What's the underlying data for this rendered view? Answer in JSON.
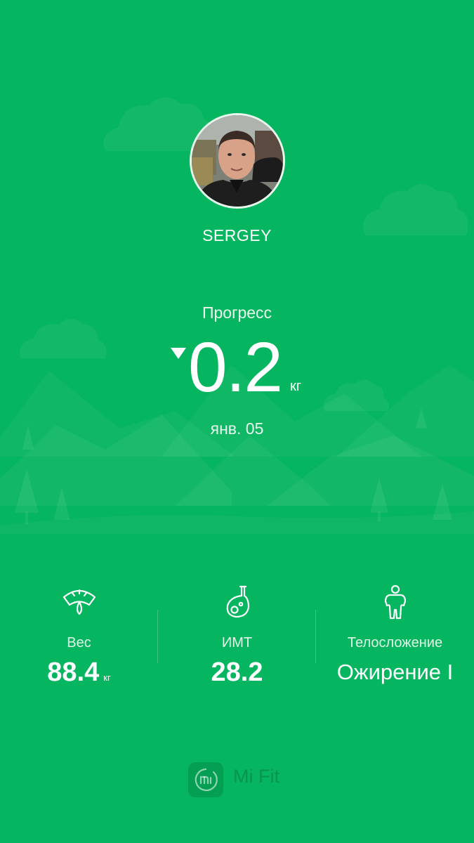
{
  "app": {
    "brand_name": "Mi Fit",
    "accent_color": "#06b55f",
    "icons": {
      "brand_logo": "mi-logo-icon",
      "trend": "triangle-down-icon"
    }
  },
  "profile": {
    "name": "SERGEY",
    "avatar_icon": "user-photo"
  },
  "progress": {
    "label": "Прогресс",
    "direction": "down",
    "value": "0.2",
    "unit": "кг",
    "date": "янв. 05"
  },
  "stats": [
    {
      "icon": "scale-icon",
      "label": "Вес",
      "value": "88.4",
      "unit": "кг"
    },
    {
      "icon": "bmi-flask-icon",
      "label": "ИМТ",
      "value": "28.2"
    },
    {
      "icon": "body-figure-icon",
      "label": "Телосложение",
      "value": "Ожирение I"
    }
  ]
}
